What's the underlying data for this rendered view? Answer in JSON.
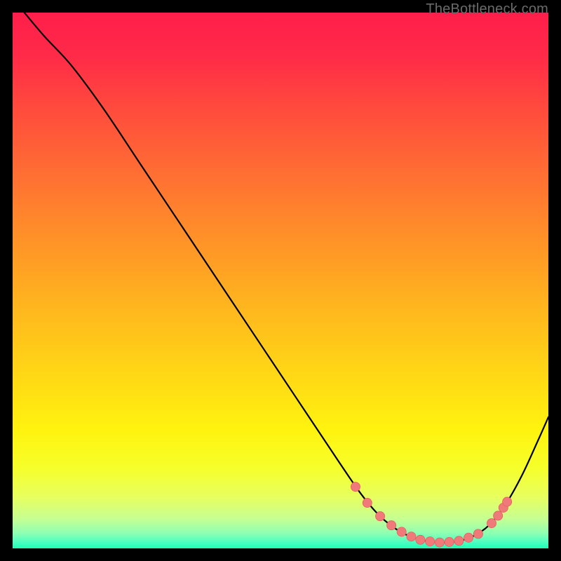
{
  "attribution": "TheBottleneck.com",
  "colors": {
    "gradient_stops": [
      {
        "offset": 0.0,
        "color": "#ff1e4b"
      },
      {
        "offset": 0.08,
        "color": "#ff2a48"
      },
      {
        "offset": 0.18,
        "color": "#ff4b3d"
      },
      {
        "offset": 0.3,
        "color": "#ff6e33"
      },
      {
        "offset": 0.42,
        "color": "#ff9128"
      },
      {
        "offset": 0.55,
        "color": "#ffb61e"
      },
      {
        "offset": 0.68,
        "color": "#ffd915"
      },
      {
        "offset": 0.78,
        "color": "#fff30f"
      },
      {
        "offset": 0.85,
        "color": "#f6ff2a"
      },
      {
        "offset": 0.905,
        "color": "#e7ff60"
      },
      {
        "offset": 0.945,
        "color": "#c6ff92"
      },
      {
        "offset": 0.972,
        "color": "#8dffb3"
      },
      {
        "offset": 0.988,
        "color": "#4effc0"
      },
      {
        "offset": 1.0,
        "color": "#1effb5"
      }
    ],
    "curve_stroke": "#000000",
    "dot_fill": "#f07a7a",
    "dot_stroke": "#e86060"
  },
  "chart_data": {
    "type": "line",
    "title": "",
    "xlabel": "",
    "ylabel": "",
    "xlim": [
      0,
      100
    ],
    "ylim": [
      0,
      100
    ],
    "series": [
      {
        "name": "curve",
        "points": [
          {
            "x": 2.2,
            "y": 100.0
          },
          {
            "x": 6.0,
            "y": 95.5
          },
          {
            "x": 11.0,
            "y": 90.1
          },
          {
            "x": 17.0,
            "y": 82.0
          },
          {
            "x": 24.0,
            "y": 71.5
          },
          {
            "x": 32.0,
            "y": 59.5
          },
          {
            "x": 40.0,
            "y": 47.5
          },
          {
            "x": 48.0,
            "y": 35.5
          },
          {
            "x": 55.0,
            "y": 25.0
          },
          {
            "x": 61.0,
            "y": 16.0
          },
          {
            "x": 65.0,
            "y": 10.2
          },
          {
            "x": 68.0,
            "y": 6.6
          },
          {
            "x": 71.0,
            "y": 4.0
          },
          {
            "x": 74.0,
            "y": 2.3
          },
          {
            "x": 77.0,
            "y": 1.4
          },
          {
            "x": 80.0,
            "y": 1.1
          },
          {
            "x": 83.0,
            "y": 1.3
          },
          {
            "x": 86.0,
            "y": 2.3
          },
          {
            "x": 89.0,
            "y": 4.4
          },
          {
            "x": 92.0,
            "y": 8.2
          },
          {
            "x": 95.0,
            "y": 13.5
          },
          {
            "x": 98.0,
            "y": 20.0
          },
          {
            "x": 100.0,
            "y": 24.5
          }
        ]
      },
      {
        "name": "highlighted-dots",
        "points": [
          {
            "x": 64.0,
            "y": 11.5
          },
          {
            "x": 66.2,
            "y": 8.5
          },
          {
            "x": 68.6,
            "y": 6.0
          },
          {
            "x": 70.7,
            "y": 4.3
          },
          {
            "x": 72.6,
            "y": 3.1
          },
          {
            "x": 74.4,
            "y": 2.2
          },
          {
            "x": 76.1,
            "y": 1.6
          },
          {
            "x": 77.9,
            "y": 1.3
          },
          {
            "x": 79.7,
            "y": 1.1
          },
          {
            "x": 81.5,
            "y": 1.2
          },
          {
            "x": 83.3,
            "y": 1.4
          },
          {
            "x": 85.1,
            "y": 2.0
          },
          {
            "x": 86.9,
            "y": 2.7
          },
          {
            "x": 89.4,
            "y": 4.7
          },
          {
            "x": 90.6,
            "y": 6.1
          },
          {
            "x": 91.6,
            "y": 7.6
          },
          {
            "x": 92.3,
            "y": 8.7
          }
        ]
      }
    ]
  }
}
